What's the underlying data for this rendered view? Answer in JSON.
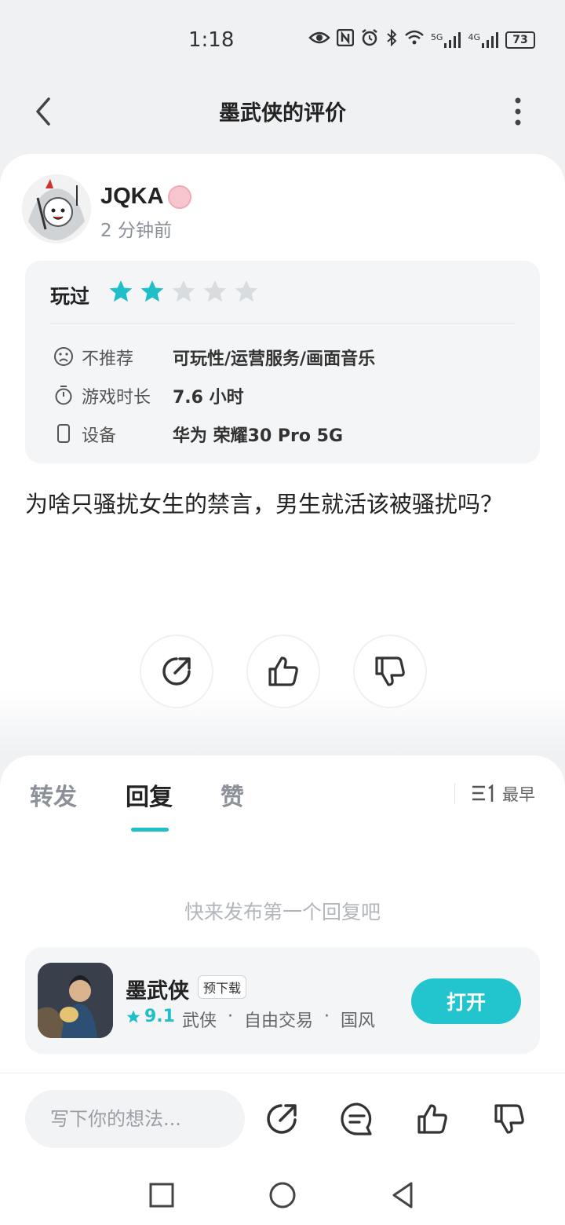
{
  "status_bar": {
    "time": "1:18",
    "battery": "73",
    "signal1": "5G",
    "signal2": "4G"
  },
  "nav": {
    "title": "墨武侠的评价"
  },
  "review": {
    "user_name": "JQKA",
    "post_time": "2 分钟前",
    "played_label": "玩过",
    "rating": 2,
    "rating_max": 5,
    "rows": [
      {
        "key": "不推荐",
        "value": "可玩性/运营服务/画面音乐",
        "icon": "sad-face-icon"
      },
      {
        "key": "游戏时长",
        "value": "7.6 小时",
        "icon": "stopwatch-icon"
      },
      {
        "key": "设备",
        "value": "华为 荣耀30 Pro 5G",
        "icon": "phone-icon"
      }
    ],
    "text": "为啥只骚扰女生的禁言，男生就活该被骚扰吗？"
  },
  "tabs": [
    {
      "label": "转发",
      "active": false
    },
    {
      "label": "回复",
      "active": true
    },
    {
      "label": "赞",
      "active": false
    }
  ],
  "sort": {
    "label": "最早"
  },
  "empty_hint": "快来发布第一个回复吧",
  "game": {
    "name": "墨武侠",
    "tag": "预下载",
    "rating": "9.1",
    "tags": [
      "武侠",
      "·",
      "自由交易",
      "·",
      "国风"
    ],
    "open_label": "打开"
  },
  "bottom": {
    "placeholder": "写下你的想法..."
  },
  "colors": {
    "accent": "#1fbfc9",
    "star_off": "#d9dcdf"
  }
}
